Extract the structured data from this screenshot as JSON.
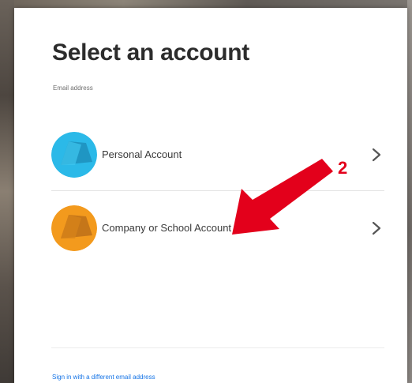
{
  "dialog": {
    "title": "Select an account",
    "email_label": "Email address"
  },
  "accounts": [
    {
      "label": "Personal Account",
      "avatar_color": "#2bb9e8",
      "avatar_shade": "#1d8fbc",
      "chevron": "chevron-right-icon"
    },
    {
      "label": "Company or School Account",
      "avatar_color": "#f39a1d",
      "avatar_shade": "#b56a18",
      "chevron": "chevron-right-icon"
    }
  ],
  "annotation": {
    "step_number": "2",
    "arrow_color": "#e3001b"
  },
  "footer": {
    "alt_signin_link": "Sign in with a different email address"
  }
}
